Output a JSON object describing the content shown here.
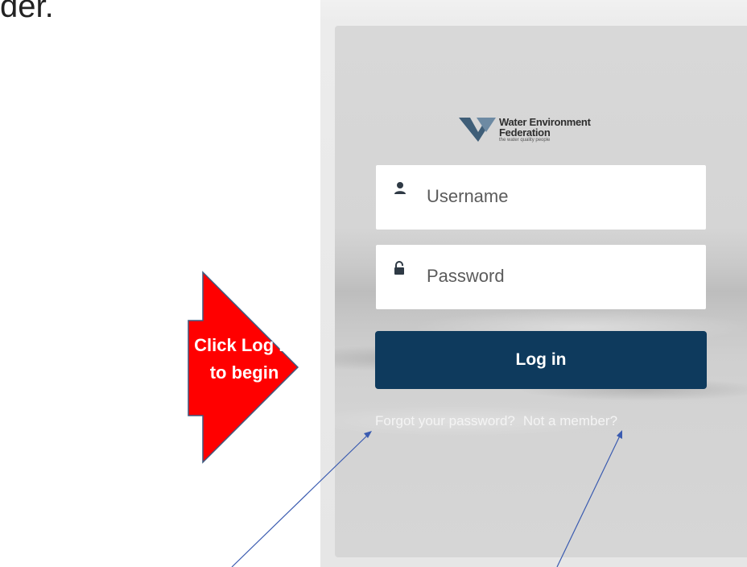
{
  "top_text": "der.",
  "logo": {
    "line1": "Water Environment",
    "line2": "Federation",
    "tagline": "the water quality people"
  },
  "form": {
    "username_placeholder": "Username",
    "password_placeholder": "Password",
    "login_label": "Log in",
    "forgot_link": "Forgot your password?",
    "member_link": "Not a member?"
  },
  "callout": {
    "line1": "Click Log in",
    "line2": "to begin",
    "color": "#ff0000"
  },
  "icons": {
    "username": "user-icon",
    "password": "lock-icon"
  },
  "colors": {
    "login_button": "#0e3a5d",
    "pointer_line": "#3a5bb0"
  }
}
